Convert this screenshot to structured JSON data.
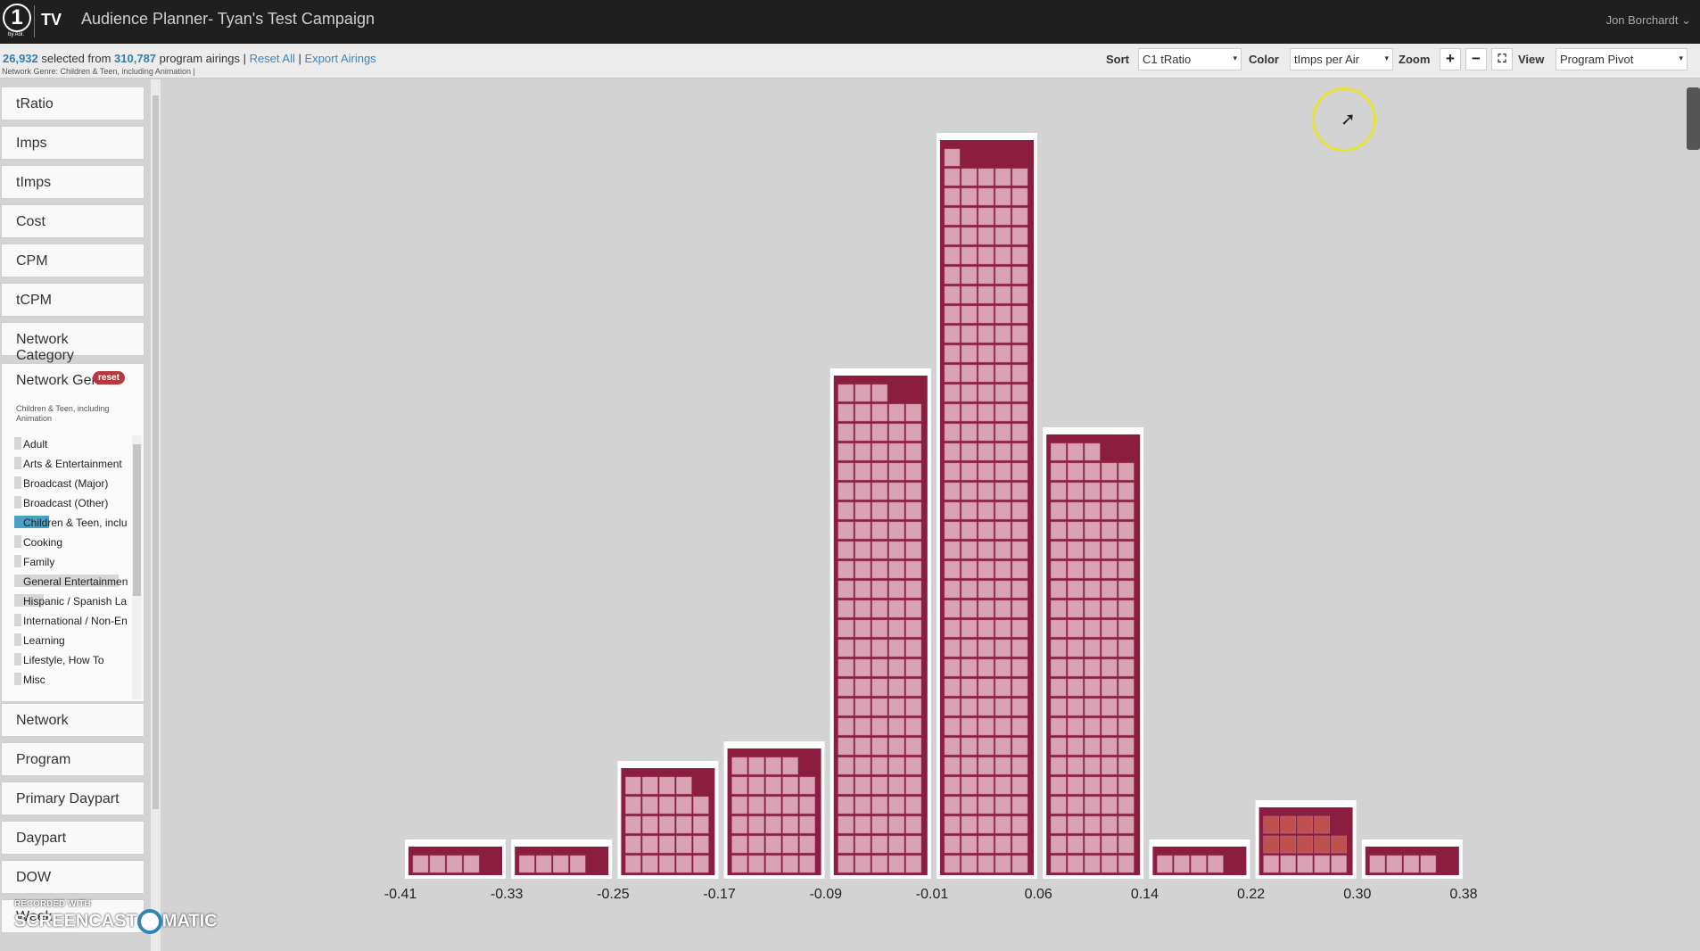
{
  "header": {
    "logo_number": "1",
    "logo_sub": "by Aol.",
    "logo_tv": "TV",
    "title": "Audience Planner- Tyan's Test Campaign",
    "user": "Jon Borchardt ⌄"
  },
  "selection": {
    "selected": "26,932",
    "from_text": " selected from ",
    "total": "310,787",
    "suffix": " program airings | ",
    "reset_all": "Reset All",
    "sep": " | ",
    "export": "Export Airings",
    "filter_note": "Network Genre: Children & Teen, including Animation |"
  },
  "controls": {
    "sort_label": "Sort",
    "sort_value": "C1 tRatio",
    "color_label": "Color",
    "color_value": "tImps per Air",
    "zoom_label": "Zoom",
    "zoom_in": "+",
    "zoom_out": "−",
    "fullscreen": "⛶",
    "view_label": "View",
    "view_value": "Program Pivot",
    "arrow": "▾"
  },
  "sidebar": {
    "items_top": [
      "tRatio",
      "Imps",
      "tImps",
      "Cost",
      "CPM",
      "tCPM",
      "Network Category"
    ],
    "genre": {
      "title": "Network Genre",
      "reset": "reset",
      "subtitle": "Children & Teen, including Animation",
      "options": [
        {
          "label": "Adult",
          "active": false,
          "weight": 0.05
        },
        {
          "label": "Arts & Entertainment",
          "active": false,
          "weight": 0.05
        },
        {
          "label": "Broadcast (Major)",
          "active": false,
          "weight": 0.05
        },
        {
          "label": "Broadcast (Other)",
          "active": false,
          "weight": 0.05
        },
        {
          "label": "Children & Teen, inclu",
          "active": true,
          "weight": 0.3
        },
        {
          "label": "Cooking",
          "active": false,
          "weight": 0.05
        },
        {
          "label": "Family",
          "active": false,
          "weight": 0.05
        },
        {
          "label": "General Entertainmen",
          "active": false,
          "weight": 0.9
        },
        {
          "label": "Hispanic / Spanish La",
          "active": false,
          "weight": 0.25
        },
        {
          "label": "International / Non-En",
          "active": false,
          "weight": 0.05
        },
        {
          "label": "Learning",
          "active": false,
          "weight": 0.05
        },
        {
          "label": "Lifestyle, How To",
          "active": false,
          "weight": 0.05
        },
        {
          "label": "Misc",
          "active": false,
          "weight": 0.05
        }
      ]
    },
    "items_bottom": [
      "Network",
      "Program",
      "Primary Daypart",
      "Daypart",
      "DOW",
      "Week"
    ]
  },
  "watermark": {
    "small": "RECORDED WITH",
    "big_left": "SCREENCAST",
    "big_right": "MATIC"
  },
  "chart_data": {
    "type": "bar",
    "categories": [
      "-0.41",
      "-0.33",
      "-0.25",
      "-0.17",
      "-0.09",
      "-0.01",
      "0.06",
      "0.14",
      "0.22",
      "0.30",
      "0.38"
    ],
    "values": [
      4,
      4,
      24,
      29,
      123,
      181,
      108,
      4,
      14,
      4
    ],
    "bar_color": "#8b1e3f",
    "tile_color": "#d9a3b5",
    "highlight_color": "#c0504d"
  }
}
